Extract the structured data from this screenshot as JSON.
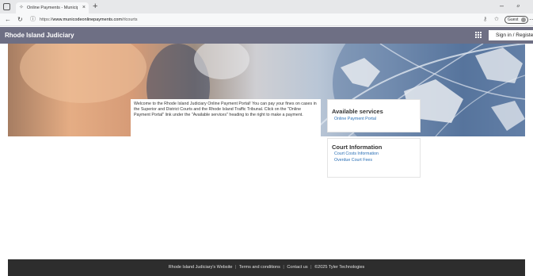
{
  "browser": {
    "tab_title": "Online Payments - Municipal Ter",
    "url_prefix": "https://",
    "url_domain": "www.municodeonlinepayments.com",
    "url_path": "/rlcourts",
    "profile_label": "Guest"
  },
  "header": {
    "app_title": "Rhode Island Judiciary",
    "signin_label": "Sign in / Register"
  },
  "welcome": {
    "text": "Welcome to the Rhode Island Judiciary Online Payment Portal! You can pay your fines on cases in the Superior and District Courts and the Rhode Island Traffic Tribunal. Click on the \"Online Payment Portal\" link under the \"Available services\" heading to the right to make a payment."
  },
  "services": {
    "heading": "Available services",
    "links": [
      "Online Payment Portal"
    ]
  },
  "court_info": {
    "heading": "Court Information",
    "links": [
      "Court Costs Information",
      "Overdue Court Fees"
    ]
  },
  "footer": {
    "website_link": "Rhode Island Judiciary's Website",
    "separator": "|",
    "terms_link": "Terms and conditions",
    "contact_link": "Contact us",
    "copyright": "©2025 Tyler Technologies"
  },
  "colors": {
    "header_bg": "#6e6f84",
    "link": "#2a6fb5",
    "footer_bg": "#2d2d2d"
  }
}
